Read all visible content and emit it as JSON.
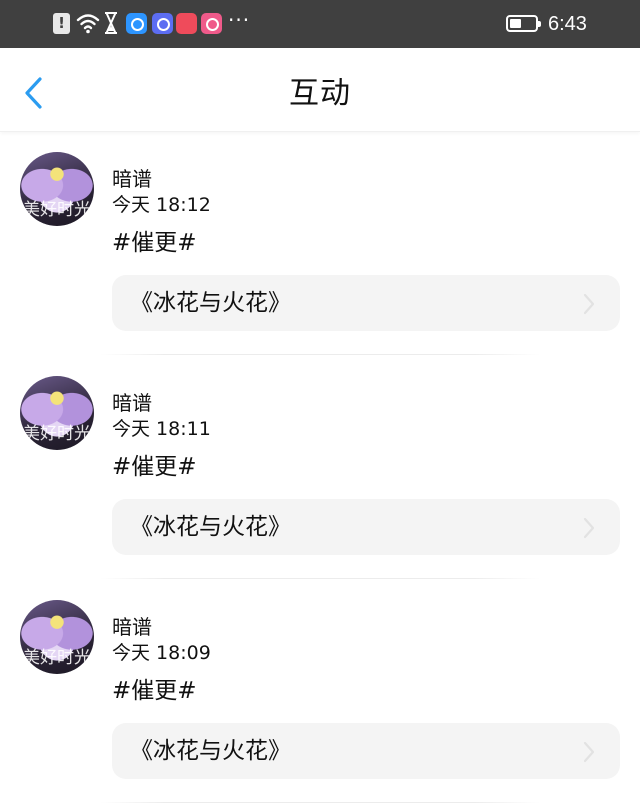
{
  "status_bar": {
    "time": "6:43",
    "dots": "···",
    "icons": [
      "alert-icon",
      "wifi-icon",
      "hourglass-icon",
      "search-app-icon",
      "music-app-icon",
      "store-app-icon",
      "chat-app-icon",
      "battery-icon"
    ]
  },
  "header": {
    "title": "互动",
    "back_icon": "chevron-left-icon",
    "accent_color": "#2b9cf0"
  },
  "feed": {
    "items": [
      {
        "avatar_text": "美好时光",
        "username": "暗谱",
        "time": "今天 18:12",
        "message": "#催更#",
        "card_title": "《冰花与火花》"
      },
      {
        "avatar_text": "美好时光",
        "username": "暗谱",
        "time": "今天 18:11",
        "message": "#催更#",
        "card_title": "《冰花与火花》"
      },
      {
        "avatar_text": "美好时光",
        "username": "暗谱",
        "time": "今天 18:09",
        "message": "#催更#",
        "card_title": "《冰花与火花》"
      }
    ]
  }
}
